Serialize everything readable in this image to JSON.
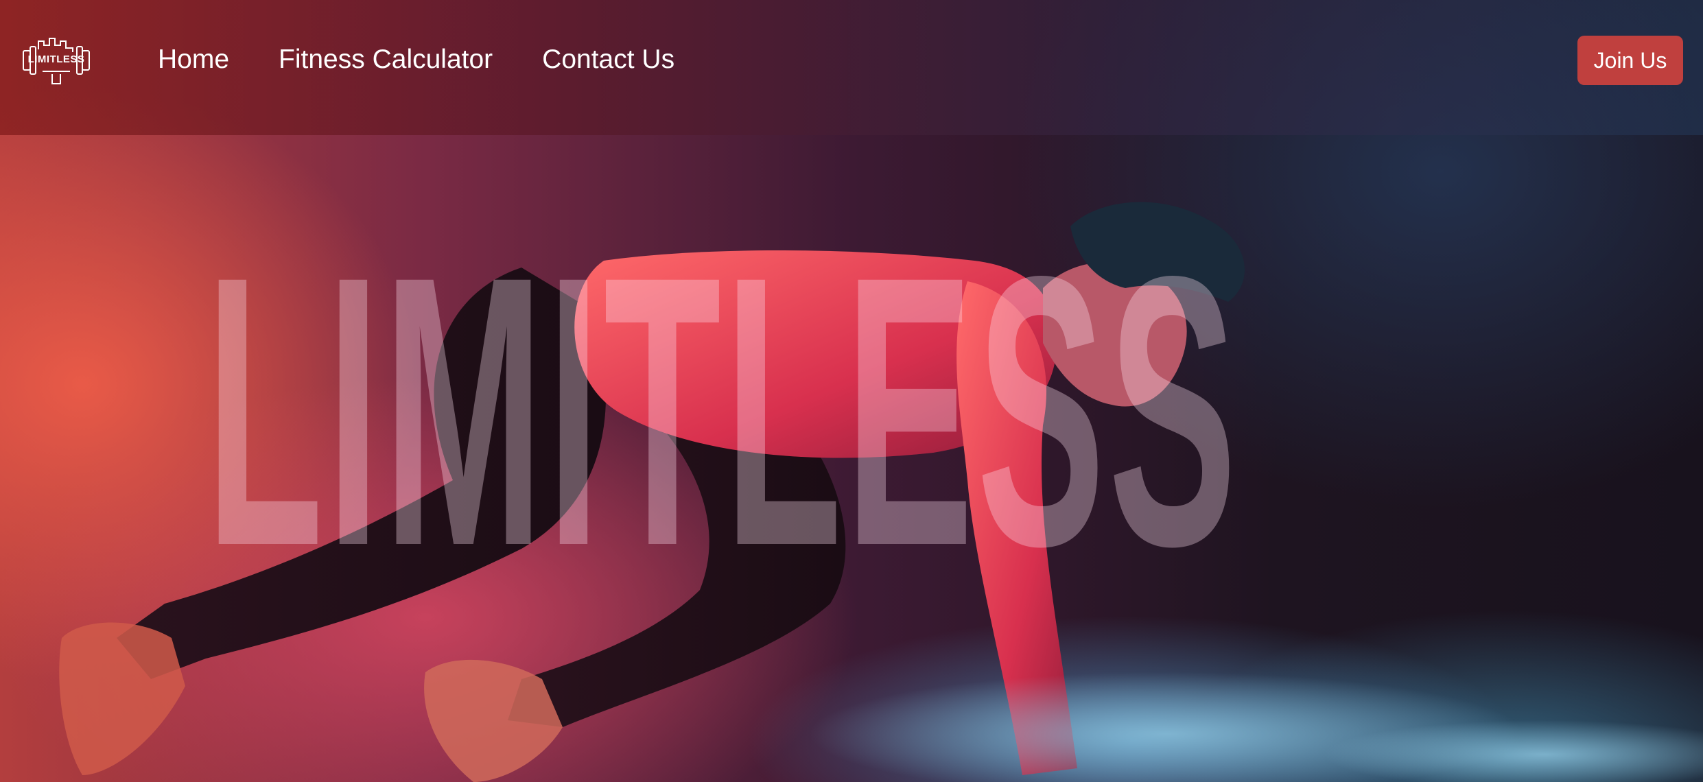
{
  "header": {
    "logo": {
      "text": "LIMITLESS",
      "icon": "dumbbell-city-logo-icon"
    },
    "nav": {
      "items": [
        {
          "label": "Home"
        },
        {
          "label": "Fitness Calculator"
        },
        {
          "label": "Contact Us"
        }
      ]
    },
    "join_label": "Join Us"
  },
  "hero": {
    "title": "LIMITLESS",
    "image": "athlete-sprint-start-photo"
  },
  "colors": {
    "accent": "#c0403e",
    "header_left": "#801a1a",
    "header_right": "#223452",
    "title_overlay": "#ffe1f0"
  }
}
